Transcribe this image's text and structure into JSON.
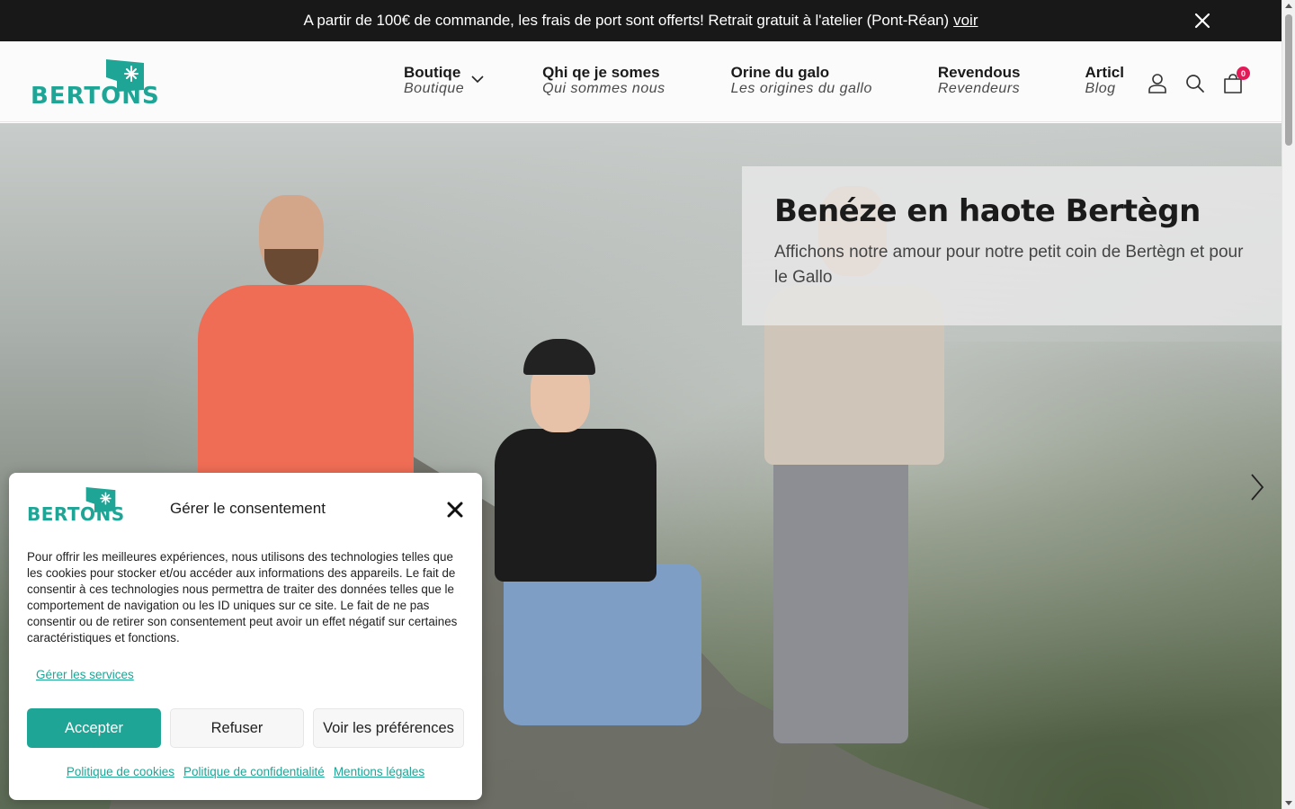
{
  "announcement": {
    "message": "A partir de 100€ de commande, les frais de port sont offerts! Retrait gratuit à l'atelier (Pont-Réan)",
    "link_label": "voir"
  },
  "brand": {
    "name": "BERTONS",
    "color": "#1fa596"
  },
  "nav": {
    "items": [
      {
        "label": "Boutiqe",
        "sub": "Boutique"
      },
      {
        "label": "Qhi qe je somes",
        "sub": "Qui sommes nous"
      },
      {
        "label": "Orine du galo",
        "sub": "Les origines du gallo"
      },
      {
        "label": "Revendous",
        "sub": "Revendeurs"
      },
      {
        "label": "Articl",
        "sub": "Blog"
      }
    ],
    "icons": [
      "user-icon",
      "search-icon",
      "cart-icon"
    ],
    "cart_count": "0"
  },
  "hero": {
    "title": "Benéze en haote Bertègn",
    "subtitle": "Affichons notre amour pour notre petit coin de Bertègn et pour le Gallo"
  },
  "cookie": {
    "title": "Gérer le consentement",
    "text": "Pour offrir les meilleures expériences, nous utilisons des technologies telles que les cookies pour stocker et/ou accéder aux informations des appareils. Le fait de consentir à ces technologies nous permettra de traiter des données telles que le comportement de navigation ou les ID uniques sur ce site. Le fait de ne pas consentir ou de retirer son consentement peut avoir un effet négatif sur certaines caractéristiques et fonctions.",
    "services_link": "Gérer les services",
    "accept": "Accepter",
    "refuse": "Refuser",
    "preferences": "Voir les préférences",
    "links": [
      "Politique de cookies",
      "Politique de confidentialité",
      "Mentions légales"
    ]
  },
  "colors": {
    "accent": "#1fa596",
    "badge": "#e51957",
    "topbar": "#181818"
  }
}
